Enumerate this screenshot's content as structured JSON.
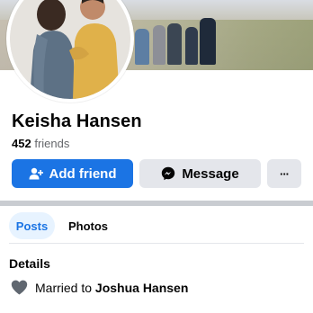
{
  "profile": {
    "name": "Keisha Hansen",
    "friend_count": "452",
    "friends_label": "friends"
  },
  "actions": {
    "add_friend_label": "Add friend",
    "message_label": "Message",
    "more_label": "···"
  },
  "tabs": [
    {
      "label": "Posts",
      "active": true
    },
    {
      "label": "Photos",
      "active": false
    }
  ],
  "details": {
    "title": "Details",
    "relationship_prefix": "Married to",
    "relationship_partner": "Joshua Hansen",
    "relationship_icon": "heart-icon"
  },
  "colors": {
    "primary": "#1b74e4",
    "button_gray": "#e4e6eb",
    "tab_active_bg": "#e7f3ff"
  }
}
